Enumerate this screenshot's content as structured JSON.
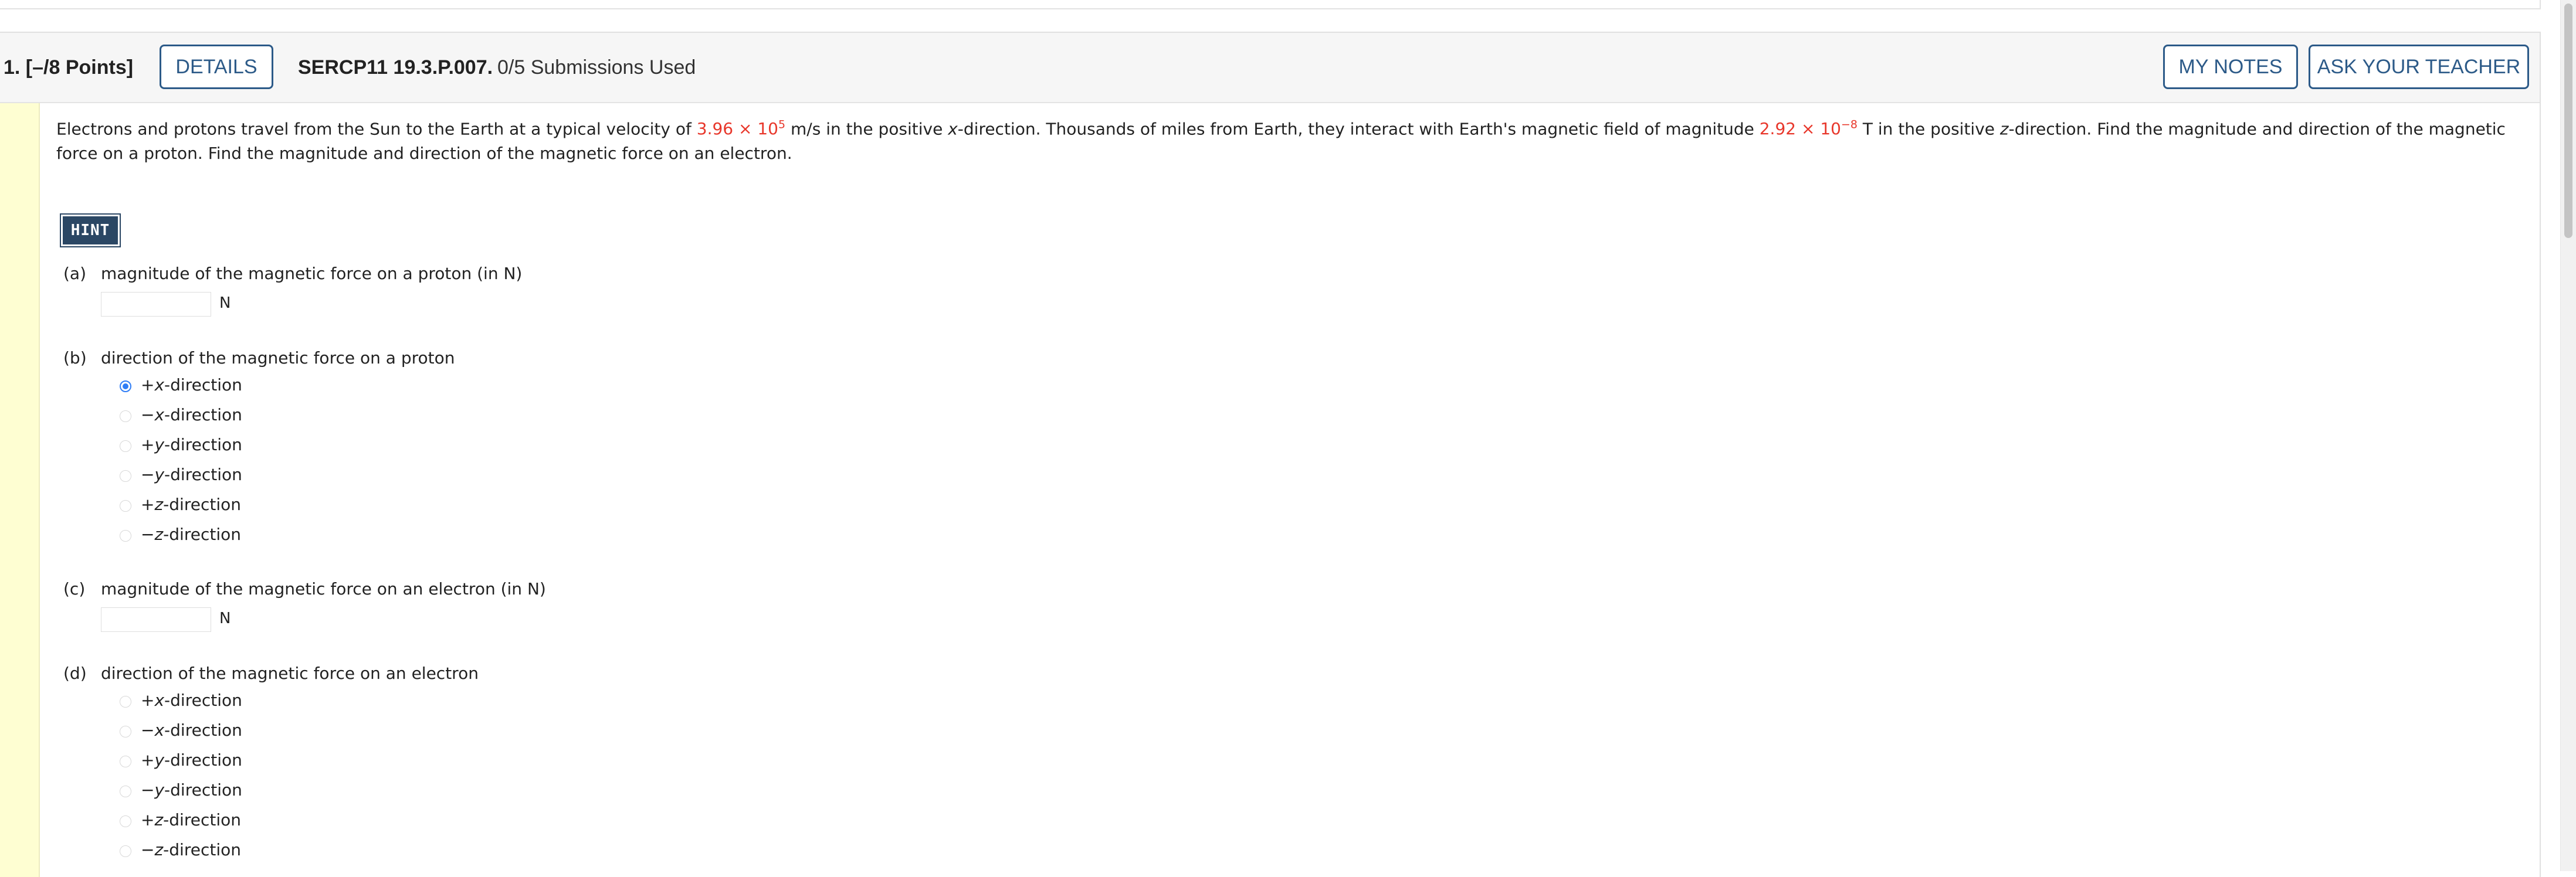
{
  "question": {
    "number_points": "1. [–/8 Points]",
    "details_label": "DETAILS",
    "code": "SERCP11 19.3.P.007.",
    "submissions": "0/5 Submissions Used",
    "my_notes_label": "MY NOTES",
    "ask_teacher_label": "ASK YOUR TEACHER"
  },
  "problem": {
    "t1": "Electrons and protons travel from the Sun to the Earth at a typical velocity of ",
    "v_mantissa": "3.96 × 10",
    "v_exp": "5",
    "t2": " m/s in the positive ",
    "x_var": "x",
    "t3": "-direction. Thousands of miles from Earth, they interact with Earth's magnetic field of magnitude ",
    "b_mantissa": "2.92 × 10",
    "b_exp": "−8",
    "t4": " T in the positive ",
    "z_var": "z",
    "t5": "-direction. Find the magnitude and direction of the magnetic force on a proton. Find the magnitude and direction of the magnetic force on an electron."
  },
  "hint_label": "HINT",
  "parts": {
    "a": {
      "tag": "(a)",
      "text": "magnitude of the magnetic force on a proton (in N)",
      "value": "",
      "unit": "N"
    },
    "b": {
      "tag": "(b)",
      "text": "direction of the magnetic force on a proton",
      "selected": "+x-direction"
    },
    "c": {
      "tag": "(c)",
      "text": "magnitude of the magnetic force on an electron (in N)",
      "value": "",
      "unit": "N"
    },
    "d": {
      "tag": "(d)",
      "text": "direction of the magnetic force on an electron",
      "selected": ""
    }
  },
  "options": [
    {
      "sign": "+",
      "axis": "x",
      "suffix": "-direction"
    },
    {
      "sign": "−",
      "axis": "x",
      "suffix": "-direction"
    },
    {
      "sign": "+",
      "axis": "y",
      "suffix": "-direction"
    },
    {
      "sign": "−",
      "axis": "y",
      "suffix": "-direction"
    },
    {
      "sign": "+",
      "axis": "z",
      "suffix": "-direction"
    },
    {
      "sign": "−",
      "axis": "z",
      "suffix": "-direction"
    }
  ],
  "colors": {
    "accent": "#2c5a88",
    "given_value": "#e8372b",
    "hint_bg": "#2b4764",
    "left_bar": "#fefed2",
    "radio_selected": "#2f7df6"
  }
}
